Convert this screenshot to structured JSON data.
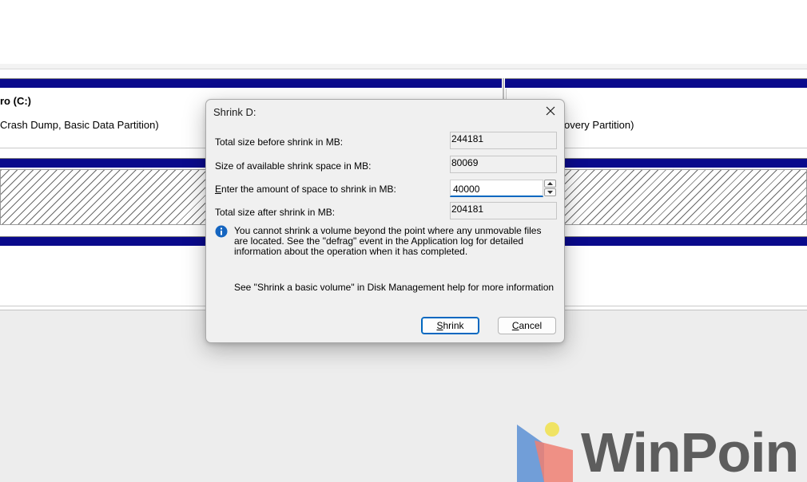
{
  "background": {
    "volume_c_title": "ro  (C:)",
    "volume_c_desc": "Crash Dump, Basic Data Partition)",
    "recovery_desc": "overy Partition)"
  },
  "dialog": {
    "title": "Shrink D:",
    "fields": {
      "total_before_label": "Total size before shrink in MB:",
      "total_before_value": "244181",
      "available_label": "Size of available shrink space in MB:",
      "available_value": "80069",
      "enter_label_prefix": "E",
      "enter_label_rest": "nter the amount of space to shrink in MB:",
      "enter_value": "40000",
      "total_after_label": "Total size after shrink in MB:",
      "total_after_value": "204181"
    },
    "info_message": "You cannot shrink a volume beyond the point where any unmovable files are located. See the \"defrag\" event in the Application log for detailed information about the operation when it has completed.",
    "help_message": "See \"Shrink a basic volume\" in Disk Management help for more information",
    "buttons": {
      "shrink_prefix": "S",
      "shrink_rest": "hrink",
      "cancel_prefix": "C",
      "cancel_rest": "ancel"
    }
  },
  "watermark": {
    "brand": "WinPoin"
  },
  "colors": {
    "volume_bar": "#0a0a8c",
    "accent": "#0067c0",
    "info_icon": "#1565c0"
  },
  "icons": {
    "close": "close-icon",
    "info": "info-icon",
    "spin_up": "chevron-up-icon",
    "spin_down": "chevron-down-icon"
  }
}
